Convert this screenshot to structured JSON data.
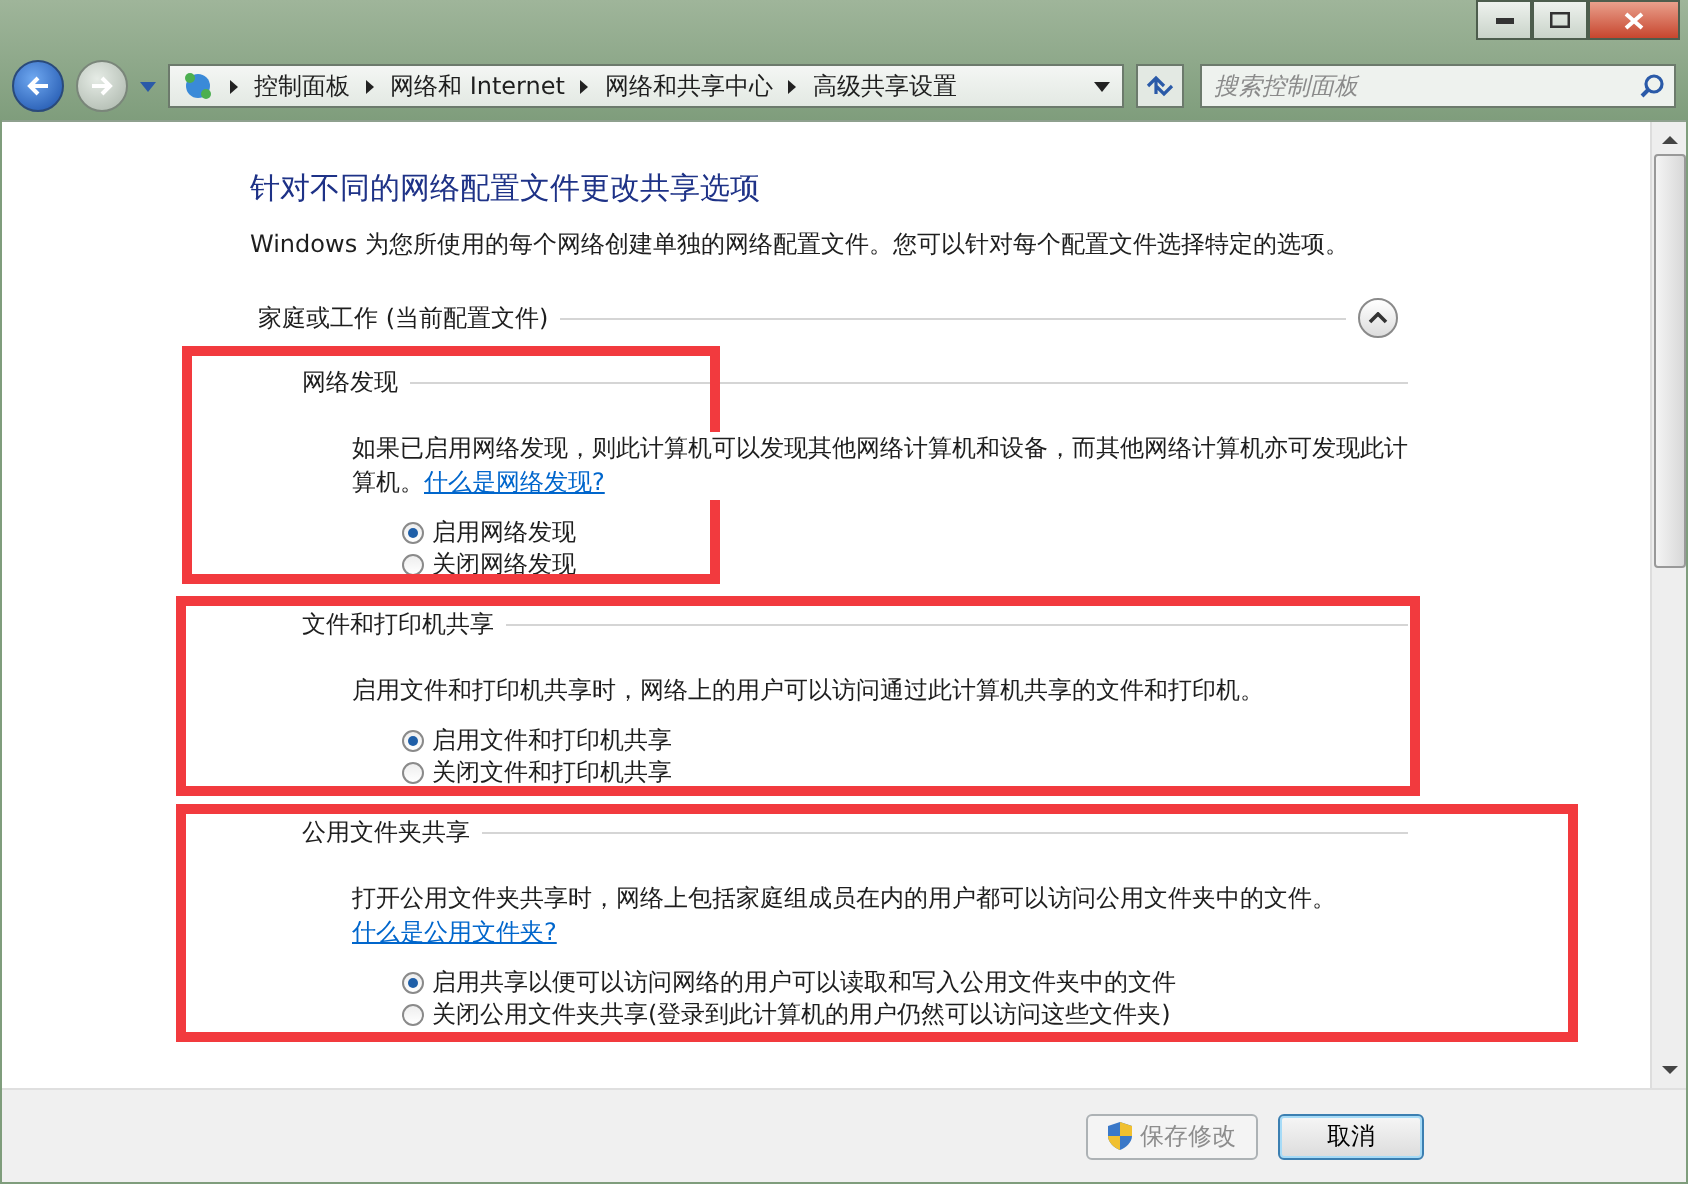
{
  "window": {
    "breadcrumb": [
      "控制面板",
      "网络和 Internet",
      "网络和共享中心",
      "高级共享设置"
    ],
    "search": {
      "placeholder": "搜索控制面板"
    }
  },
  "page": {
    "title": "针对不同的网络配置文件更改共享选项",
    "description": "Windows 为您所使用的每个网络创建单独的网络配置文件。您可以针对每个配置文件选择特定的选项。"
  },
  "profile": {
    "title": "家庭或工作 (当前配置文件)",
    "expanded": true,
    "sections": [
      {
        "title": "网络发现",
        "description": "如果已启用网络发现，则此计算机可以发现其他网络计算机和设备，而其他网络计算机亦可发现此计算机。",
        "link": "什么是网络发现?",
        "highlighted": true,
        "options": [
          {
            "label": "启用网络发现",
            "selected": true
          },
          {
            "label": "关闭网络发现",
            "selected": false
          }
        ]
      },
      {
        "title": "文件和打印机共享",
        "description": "启用文件和打印机共享时，网络上的用户可以访问通过此计算机共享的文件和打印机。",
        "highlighted": true,
        "options": [
          {
            "label": "启用文件和打印机共享",
            "selected": true
          },
          {
            "label": "关闭文件和打印机共享",
            "selected": false
          }
        ]
      },
      {
        "title": "公用文件夹共享",
        "description": "打开公用文件夹共享时，网络上包括家庭组成员在内的用户都可以访问公用文件夹中的文件。",
        "link": "什么是公用文件夹?",
        "highlighted": true,
        "options": [
          {
            "label": "启用共享以便可以访问网络的用户可以读取和写入公用文件夹中的文件",
            "selected": true
          },
          {
            "label": "关闭公用文件夹共享(登录到此计算机的用户仍然可以访问这些文件夹)",
            "selected": false
          }
        ]
      }
    ]
  },
  "buttons": [
    {
      "label": "保存修改",
      "kind": "shield",
      "disabled": true
    },
    {
      "label": "取消",
      "kind": "plain",
      "disabled": false
    }
  ]
}
